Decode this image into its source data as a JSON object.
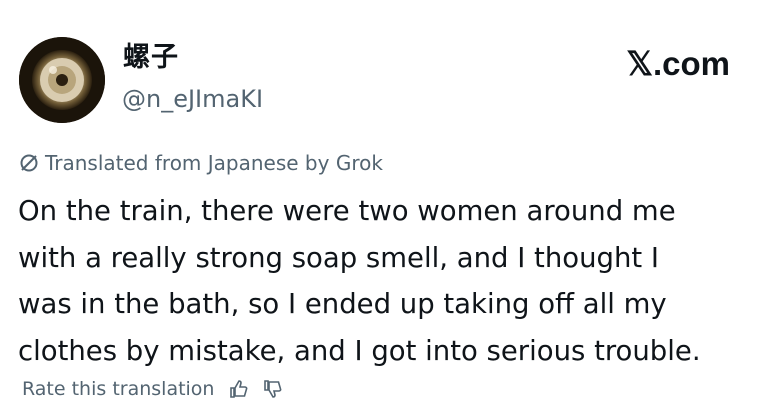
{
  "user": {
    "display_name": "螺子",
    "handle": "@n_eJImaKI"
  },
  "brand": "𝕏.com",
  "translation": {
    "label": "Translated from Japanese by Grok"
  },
  "post": {
    "lines": [
      "On the train, there were two women around me",
      "with a really strong soap smell, and I thought I",
      "was in the bath, so I ended up taking off all my",
      "clothes by mistake, and I got into serious trouble."
    ]
  },
  "rate": {
    "label": "Rate this translation"
  },
  "icons": {
    "translate": "no-entry-slash-icon",
    "thumbs_up": "thumbs-up-icon",
    "thumbs_down": "thumbs-down-icon"
  }
}
